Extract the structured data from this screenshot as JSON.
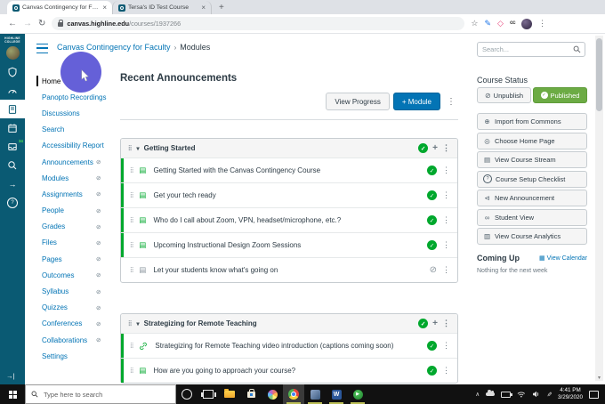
{
  "browser": {
    "tabs": [
      {
        "title": "Canvas Contingency for Faculty"
      },
      {
        "title": "Tersa's ID Test Course"
      }
    ],
    "url_domain": "canvas.highline.edu",
    "url_path": "/courses/1937266",
    "extension_cc": "cc"
  },
  "canvas": {
    "logo_line1": "HIGHLINE",
    "logo_line2": "COLLEGE",
    "inbox_badge": "34",
    "breadcrumb": {
      "course": "Canvas Contingency for Faculty",
      "separator": "›",
      "page": "Modules"
    },
    "search_placeholder": "Search...",
    "course_nav": [
      {
        "label": "Home"
      },
      {
        "label": "Panopto Recordings"
      },
      {
        "label": "Discussions"
      },
      {
        "label": "Search"
      },
      {
        "label": "Accessibility Report"
      },
      {
        "label": "Announcements"
      },
      {
        "label": "Modules"
      },
      {
        "label": "Assignments"
      },
      {
        "label": "People"
      },
      {
        "label": "Grades"
      },
      {
        "label": "Files"
      },
      {
        "label": "Pages"
      },
      {
        "label": "Outcomes"
      },
      {
        "label": "Syllabus"
      },
      {
        "label": "Quizzes"
      },
      {
        "label": "Conferences"
      },
      {
        "label": "Collaborations"
      },
      {
        "label": "Settings"
      }
    ],
    "main": {
      "heading": "Recent Announcements",
      "view_progress": "View Progress",
      "add_module": "+ Module",
      "modules": [
        {
          "title": "Getting Started",
          "items": [
            {
              "title": "Getting Started with the Canvas Contingency Course"
            },
            {
              "title": "Get your tech ready"
            },
            {
              "title": "Who do I call about Zoom, VPN, headset/microphone, etc.?"
            },
            {
              "title": "Upcoming Instructional Design Zoom Sessions"
            },
            {
              "title": "Let your students know what's going on"
            }
          ]
        },
        {
          "title": "Strategizing for Remote Teaching",
          "items": [
            {
              "title": "Strategizing for Remote Teaching video introduction (captions coming soon)"
            },
            {
              "title": "How are you going to approach your course?"
            }
          ]
        }
      ]
    },
    "sidebar": {
      "course_status": "Course Status",
      "unpublish": "Unpublish",
      "published": "Published",
      "actions": [
        {
          "label": "Import from Commons"
        },
        {
          "label": "Choose Home Page"
        },
        {
          "label": "View Course Stream"
        },
        {
          "label": "Course Setup Checklist"
        },
        {
          "label": "New Announcement"
        },
        {
          "label": "Student View"
        },
        {
          "label": "View Course Analytics"
        }
      ],
      "coming_up": "Coming Up",
      "view_calendar": "View Calendar",
      "coming_up_empty": "Nothing for the next week"
    },
    "colors": {
      "nav_teal": "#0a5a73",
      "link_blue": "#0374b5",
      "published_green": "#00a82d",
      "status_green": "#6cab44",
      "highlight_purple": "#5a55d6"
    }
  },
  "taskbar": {
    "search_placeholder": "Type here to search",
    "time": "4:41 PM",
    "date": "3/29/2020",
    "word_label": "W"
  },
  "icons": {
    "back": "←",
    "forward": "→",
    "refresh": "↻",
    "star": "☆",
    "pen": "✎",
    "shape": "◇",
    "kebab": "⋮",
    "new_tab": "+",
    "close": "×",
    "caret_down": "▾",
    "drag": "⣿",
    "page": "▤",
    "check": "✓",
    "slash": "⊘",
    "eye_off": "⊘",
    "plus": "+",
    "commons_arrow": "→",
    "expand": "→|",
    "help": "?",
    "commons": "⊕",
    "target": "◎",
    "stream": "▤",
    "megaphone": "⊲",
    "glasses": "∞",
    "analytics": "▥",
    "calendar_small": "▦",
    "chevron_up": "∧",
    "play": "▶"
  }
}
